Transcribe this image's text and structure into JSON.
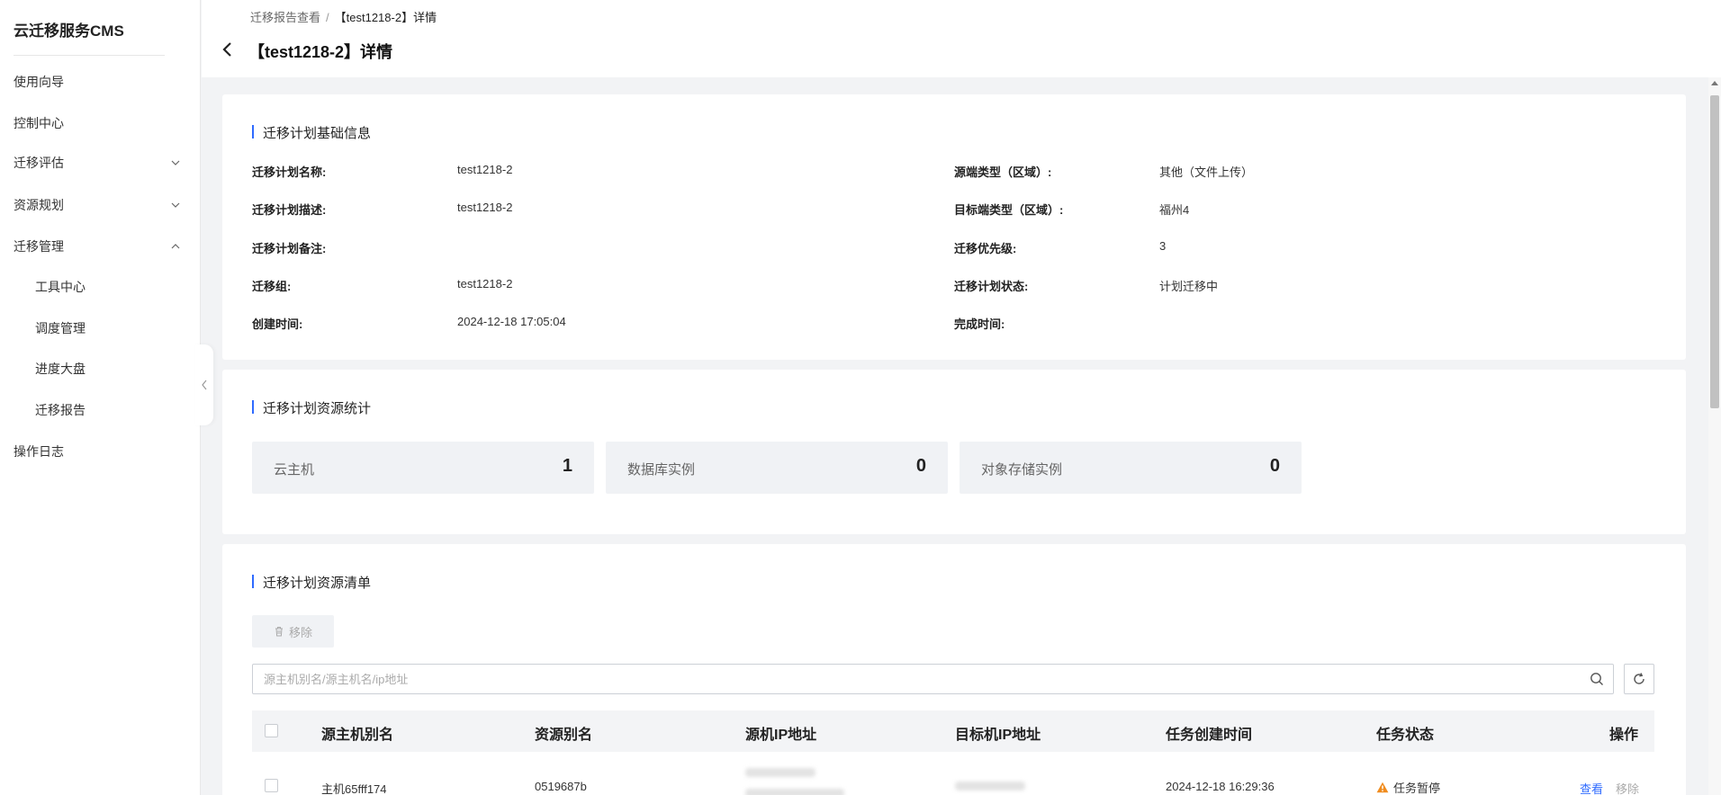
{
  "app": {
    "brand": "云迁移服务CMS"
  },
  "sidebar": {
    "items": [
      {
        "label": "使用向导"
      },
      {
        "label": "控制中心"
      },
      {
        "label": "迁移评估"
      },
      {
        "label": "资源规划"
      },
      {
        "label": "迁移管理"
      },
      {
        "label": "工具中心"
      },
      {
        "label": "调度管理"
      },
      {
        "label": "进度大盘"
      },
      {
        "label": "迁移报告"
      },
      {
        "label": "操作日志"
      }
    ]
  },
  "header": {
    "breadcrumb": {
      "parent": "迁移报告查看",
      "separator": "/",
      "current": "【test1218-2】详情"
    },
    "title": "【test1218-2】详情"
  },
  "basic_info": {
    "title": "迁移计划基础信息",
    "left": [
      {
        "label": "迁移计划名称:",
        "value": "test1218-2"
      },
      {
        "label": "迁移计划描述:",
        "value": "test1218-2"
      },
      {
        "label": "迁移计划备注:",
        "value": ""
      },
      {
        "label": "迁移组:",
        "value": "test1218-2"
      },
      {
        "label": "创建时间:",
        "value": "2024-12-18 17:05:04"
      }
    ],
    "right": [
      {
        "label": "源端类型（区域）:",
        "value": "其他（文件上传）"
      },
      {
        "label": "目标端类型（区域）:",
        "value": "福州4"
      },
      {
        "label": "迁移优先级:",
        "value": "3"
      },
      {
        "label": "迁移计划状态:",
        "value": "计划迁移中"
      },
      {
        "label": "完成时间:",
        "value": ""
      }
    ]
  },
  "stats": {
    "title": "迁移计划资源统计",
    "items": [
      {
        "name": "云主机",
        "count": "1"
      },
      {
        "name": "数据库实例",
        "count": "0"
      },
      {
        "name": "对象存储实例",
        "count": "0"
      }
    ]
  },
  "resources": {
    "title": "迁移计划资源清单",
    "remove_label": "移除",
    "search_placeholder": "源主机别名/源主机名/ip地址",
    "columns": [
      "源主机别名",
      "资源别名",
      "源机IP地址",
      "目标机IP地址",
      "任务创建时间",
      "任务状态",
      "操作"
    ],
    "rows": [
      {
        "host_alias": "主机65fff174",
        "resource_alias": "0519687b",
        "create_time": "2024-12-18 16:29:36",
        "status": "任务暂停",
        "action_view": "查看",
        "action_remove": "移除"
      }
    ]
  },
  "colors": {
    "accent": "#2f6bff",
    "warning": "#f08c1e"
  }
}
